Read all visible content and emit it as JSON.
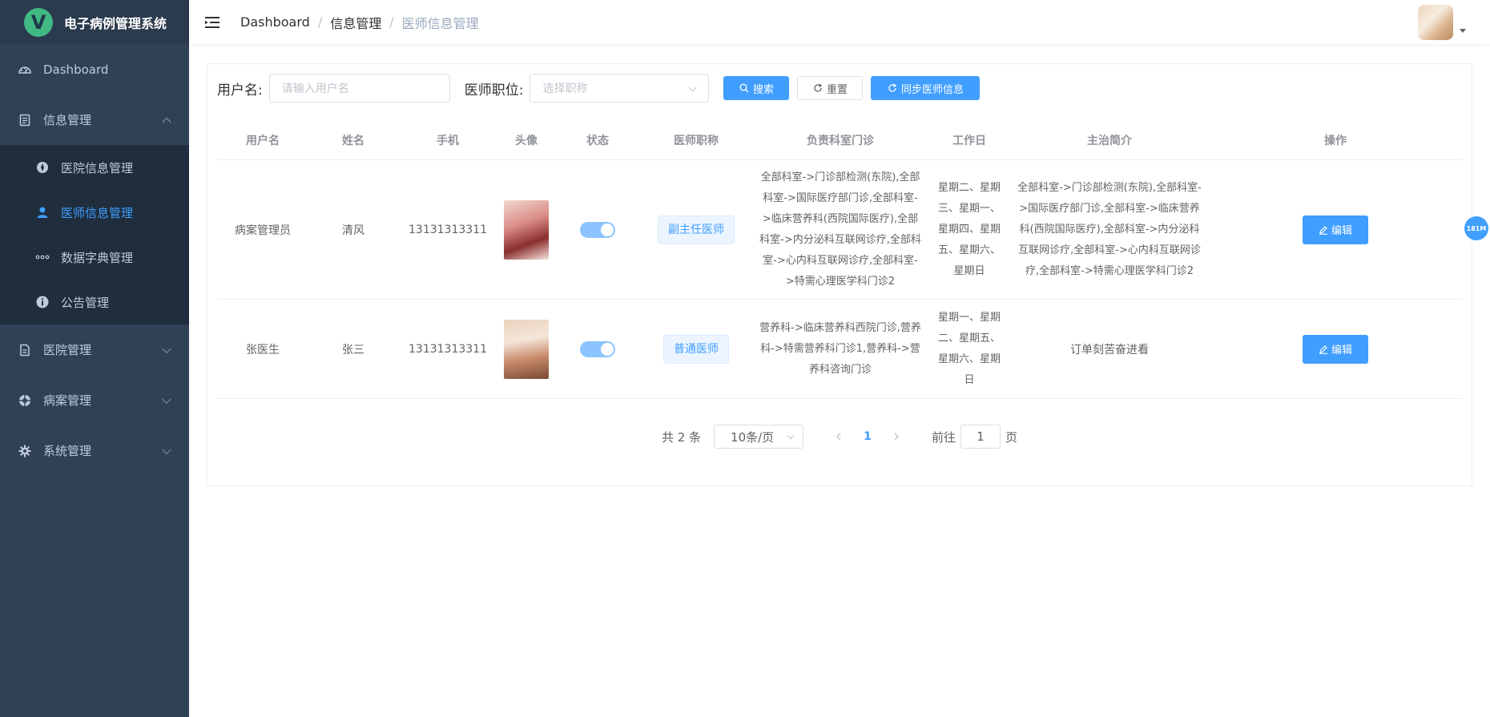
{
  "app": {
    "logo_letter": "V",
    "title": "电子病例管理系统"
  },
  "colors": {
    "sidebar_bg": "#304156",
    "submenu_bg": "#1f2d3d",
    "accent": "#409eff"
  },
  "sidebar": {
    "dashboard": "Dashboard",
    "info_mgmt": "信息管理",
    "info_children": {
      "hospital_info": "医院信息管理",
      "doctor_info": "医师信息管理",
      "dictionary": "数据字典管理",
      "announcement": "公告管理"
    },
    "hospital_mgmt": "医院管理",
    "case_mgmt": "病案管理",
    "system_mgmt": "系统管理"
  },
  "breadcrumb": {
    "b1": "Dashboard",
    "b2": "信息管理",
    "b3": "医师信息管理",
    "sep": "/"
  },
  "filters": {
    "username_label": "用户名:",
    "username_placeholder": "请输入用户名",
    "position_label": "医师职位:",
    "position_placeholder": "选择职称",
    "search_btn": "搜索",
    "reset_btn": "重置",
    "sync_btn": "同步医师信息"
  },
  "table": {
    "headers": {
      "username": "用户名",
      "name": "姓名",
      "phone": "手机",
      "avatar": "头像",
      "status": "状态",
      "title": "医师职称",
      "depts": "负责科室门诊",
      "workdays": "工作日",
      "intro": "主治简介",
      "ops": "操作"
    },
    "rows": [
      {
        "username": "病案管理员",
        "name": "清风",
        "phone": "13131313311",
        "status_on": true,
        "title": "副主任医师",
        "depts": "全部科室->门诊部检测(东院),全部科室->国际医疗部门诊,全部科室->临床营养科(西院国际医疗),全部科室->内分泌科互联网诊疗,全部科室->心内科互联网诊疗,全部科室->特需心理医学科门诊2",
        "workdays": "星期二、星期三、星期一、星期四、星期五、星期六、星期日",
        "intro": "全部科室->门诊部检测(东院),全部科室->国际医疗部门诊,全部科室->临床营养科(西院国际医疗),全部科室->内分泌科互联网诊疗,全部科室->心内科互联网诊疗,全部科室->特需心理医学科门诊2",
        "edit": "编辑"
      },
      {
        "username": "张医生",
        "name": "张三",
        "phone": "13131313311",
        "status_on": true,
        "title": "普通医师",
        "depts": "营养科->临床营养科西院门诊,营养科->特需营养科门诊1,营养科->营养科咨询门诊",
        "workdays": "星期一、星期二、星期五、星期六、星期日",
        "intro": "订单刻苦奋进看",
        "edit": "编辑"
      }
    ]
  },
  "pagination": {
    "total": "共 2 条",
    "page_size": "10条/页",
    "current_page": "1",
    "goto_prefix": "前往",
    "goto_value": "1",
    "goto_suffix": "页"
  },
  "memory_badge": "181M"
}
